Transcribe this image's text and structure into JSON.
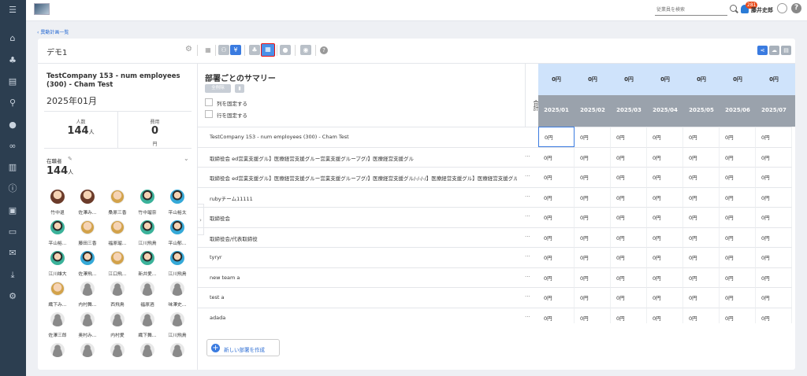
{
  "topbar": {
    "search_placeholder": "従業員を検索",
    "notification_count": "281",
    "user_name": "藤井史郎"
  },
  "breadcrumb": {
    "back_label": "異動計画一覧"
  },
  "plan": {
    "title": "デモ1"
  },
  "toolbar": {
    "yen_label": "¥"
  },
  "left": {
    "company": "TestCompany 153 - num employees (300) - Cham Test",
    "month": "2025年01月",
    "headcount_label": "人数",
    "headcount_value": "144",
    "headcount_unit": "人",
    "cost_label": "費用",
    "cost_value": "0",
    "cost_unit": "円",
    "employees_label": "在職者",
    "employees_value": "144",
    "employees_unit": "人",
    "members": [
      {
        "name": "竹中退",
        "style": "p1"
      },
      {
        "name": "佐澤み…",
        "style": "p1"
      },
      {
        "name": "桑原三香",
        "style": "p2"
      },
      {
        "name": "竹中瑠奈",
        "style": "p3"
      },
      {
        "name": "平山裕太",
        "style": "p4"
      },
      {
        "name": "平山裕…",
        "style": "p3"
      },
      {
        "name": "藤田三香",
        "style": "p2"
      },
      {
        "name": "福原瑠…",
        "style": "p2"
      },
      {
        "name": "江川飛鳥",
        "style": "p3"
      },
      {
        "name": "平山郁…",
        "style": "p4"
      },
      {
        "name": "江川雄大",
        "style": "p3"
      },
      {
        "name": "佐澤飛…",
        "style": "p4"
      },
      {
        "name": "江口飛…",
        "style": "p2"
      },
      {
        "name": "新井愛…",
        "style": "p3"
      },
      {
        "name": "江川飛鳥",
        "style": "p4"
      },
      {
        "name": "織下み…",
        "style": "p2"
      },
      {
        "name": "内村舞…",
        "style": "g"
      },
      {
        "name": "西飛鳥",
        "style": "g"
      },
      {
        "name": "福原酒",
        "style": "g"
      },
      {
        "name": "味澤史…",
        "style": "g"
      },
      {
        "name": "佐澤三郎",
        "style": "g"
      },
      {
        "name": "奥村み…",
        "style": "g"
      },
      {
        "name": "内村愛",
        "style": "g"
      },
      {
        "name": "織下舞…",
        "style": "g"
      },
      {
        "name": "江川飛鳥",
        "style": "g"
      },
      {
        "name": "",
        "style": "g"
      },
      {
        "name": "",
        "style": "g"
      },
      {
        "name": "",
        "style": "g"
      },
      {
        "name": "",
        "style": "g"
      },
      {
        "name": "",
        "style": "g"
      }
    ]
  },
  "summary": {
    "title": "部署ごとのサマリー",
    "all_delete_label": "全削除",
    "fix_columns_label": "列を固定する",
    "fix_rows_label": "行を固定する",
    "total_label": "合計",
    "add_department_label": "新しい部署を作成",
    "departments": [
      "TestCompany 153 - num employees (300) - Cham Test",
      "取締役会 ed営業支援グル】医療経営支援グルー営業支援グループグ/】医療経営支援グル",
      "取締役会 ed営業支援グル】医療経営支援グルー営業支援グループグ/】医療経営支援グル/-/-/-/】医療経営支援グル】医療経営支援グル",
      "rubyチーム11111",
      "取締役会",
      "取締役会/代表取締役",
      "tyryr",
      "new team a",
      "test a",
      "adada"
    ]
  },
  "grid": {
    "totals": [
      "0円",
      "0円",
      "0円",
      "0円",
      "0円",
      "0円",
      "0円"
    ],
    "months": [
      "2025/01",
      "2025/02",
      "2025/03",
      "2025/04",
      "2025/05",
      "2025/06",
      "2025/07"
    ],
    "cell_value": "0円"
  },
  "colors": {
    "sidebar": "#2c3e50",
    "accent": "#3a7be0",
    "header_total_bg": "#cfe3fb",
    "header_month_bg": "#9aa2ac",
    "highlight": "#e11111"
  }
}
